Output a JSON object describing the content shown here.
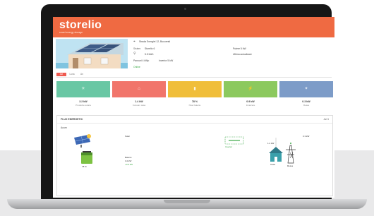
{
  "brand": {
    "name": "storelio",
    "tagline": "smart energy storage"
  },
  "colors": {
    "topbar": "#ef6a42",
    "tile_green": "#69c7a4",
    "tile_red": "#f1756b",
    "tile_yellow": "#f0be3a",
    "tile_lime": "#8cc95e",
    "tile_blue": "#7d9cc8"
  },
  "system_info": {
    "location": "Strada Energiei 12, Bucuresti",
    "system_label": "Sistem",
    "system_value": "Storelio 6",
    "capacity_value": "5.5 kWh",
    "panels_value": "Panouri 4 kWp",
    "inverter_value": "Invertor 5 kW",
    "status_value": "Online",
    "right_label_1": "Putere 5 kW",
    "right_label_2": "Ultima actualizare"
  },
  "tabs": [
    "Azi",
    "Luna",
    "An"
  ],
  "tiles": [
    {
      "value": "3.2 kW",
      "label": "Productie solara",
      "icon": "sun-icon"
    },
    {
      "value": "1.4 kW",
      "label": "Consum casa",
      "icon": "home-icon"
    },
    {
      "value": "78 %",
      "label": "Nivel baterie",
      "icon": "battery-icon"
    },
    {
      "value": "0.9 kW",
      "label": "Incarcare",
      "icon": "plug-icon"
    },
    {
      "value": "0.3 kW",
      "label": "Retea",
      "icon": "grid-icon"
    }
  ],
  "panel": {
    "title": "FLUX ENERGETIC",
    "right": "Azi ▾",
    "subtitle": "Acum"
  },
  "flow": {
    "solar_label": "Solar",
    "solar_value": "3.2 kW",
    "battery_label": "Baterie",
    "battery_value": "78 %",
    "inverter_label": "Invertor",
    "house_label": "Casa",
    "house_value": "1.4 kW",
    "grid_label": "Retea",
    "grid_value": "0.3 kW",
    "charge_value": "+0.9 kW"
  }
}
